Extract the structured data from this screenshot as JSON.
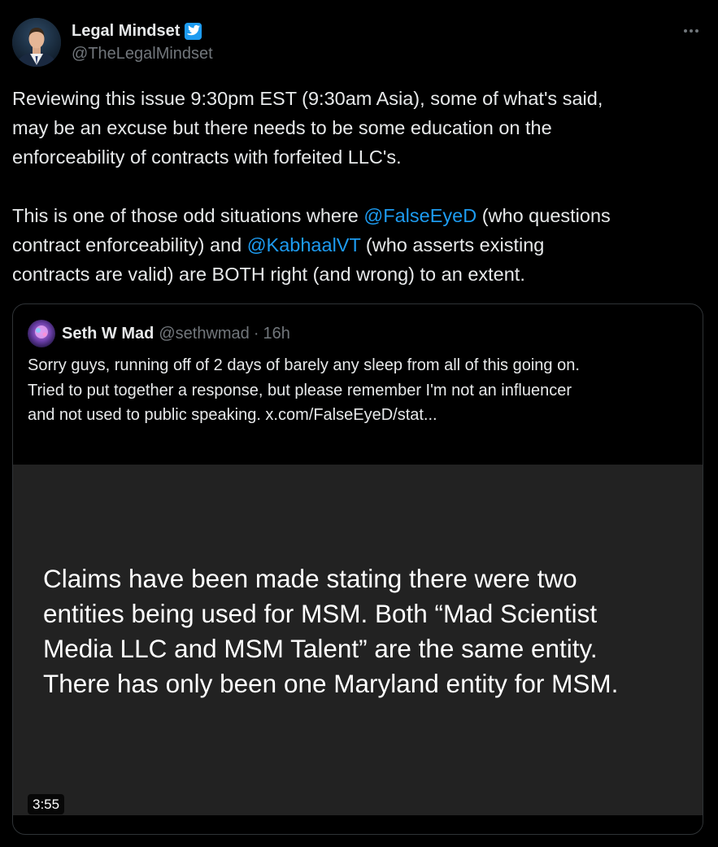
{
  "author": {
    "display_name": "Legal Mindset",
    "handle": "@TheLegalMindset",
    "verified_icon": "verified-badge-icon",
    "avatar": "avatar-photo",
    "menu_icon": "more-options-icon"
  },
  "tweet": {
    "lines": [
      [
        {
          "text": "Reviewing this issue 9:30pm EST (9:30am Asia), some of what's said,"
        }
      ],
      [
        {
          "text": "may be an excuse but there needs to be some education on the"
        }
      ],
      [
        {
          "text": "enforceability of contracts with forfeited LLC's."
        }
      ],
      [
        {
          "text": ""
        }
      ],
      [
        {
          "text": "This is one of those odd situations where "
        },
        {
          "text": "@FalseEyeD",
          "mention": true
        },
        {
          "text": " (who questions"
        }
      ],
      [
        {
          "text": "contract enforceability) and "
        },
        {
          "text": "@KabhaalVT",
          "mention": true
        },
        {
          "text": "  (who asserts existing"
        }
      ],
      [
        {
          "text": "contracts are valid) are BOTH right (and wrong) to an extent."
        }
      ]
    ]
  },
  "quote": {
    "display_name": "Seth W Mad",
    "handle": "@sethwmad",
    "separator": "·",
    "time": "16h",
    "lines": [
      "Sorry guys, running off of 2 days of barely any sleep from all of this going on.",
      "Tried to put together a response, but please remember I'm not an influencer",
      "and not used to public speaking.  x.com/FalseEyeD/stat..."
    ],
    "video": {
      "text_lines": [
        "Claims have been made stating there were two",
        "entities being used for MSM. Both “Mad Scientist",
        "Media LLC and MSM Talent” are the same entity.",
        "There has only been one Maryland entity for MSM."
      ],
      "duration": "3:55"
    }
  },
  "colors": {
    "background": "#000000",
    "text": "#e7e9ea",
    "muted": "#71767b",
    "accent": "#1d9bf0",
    "border": "#2f3336",
    "video_bg": "#222222"
  }
}
